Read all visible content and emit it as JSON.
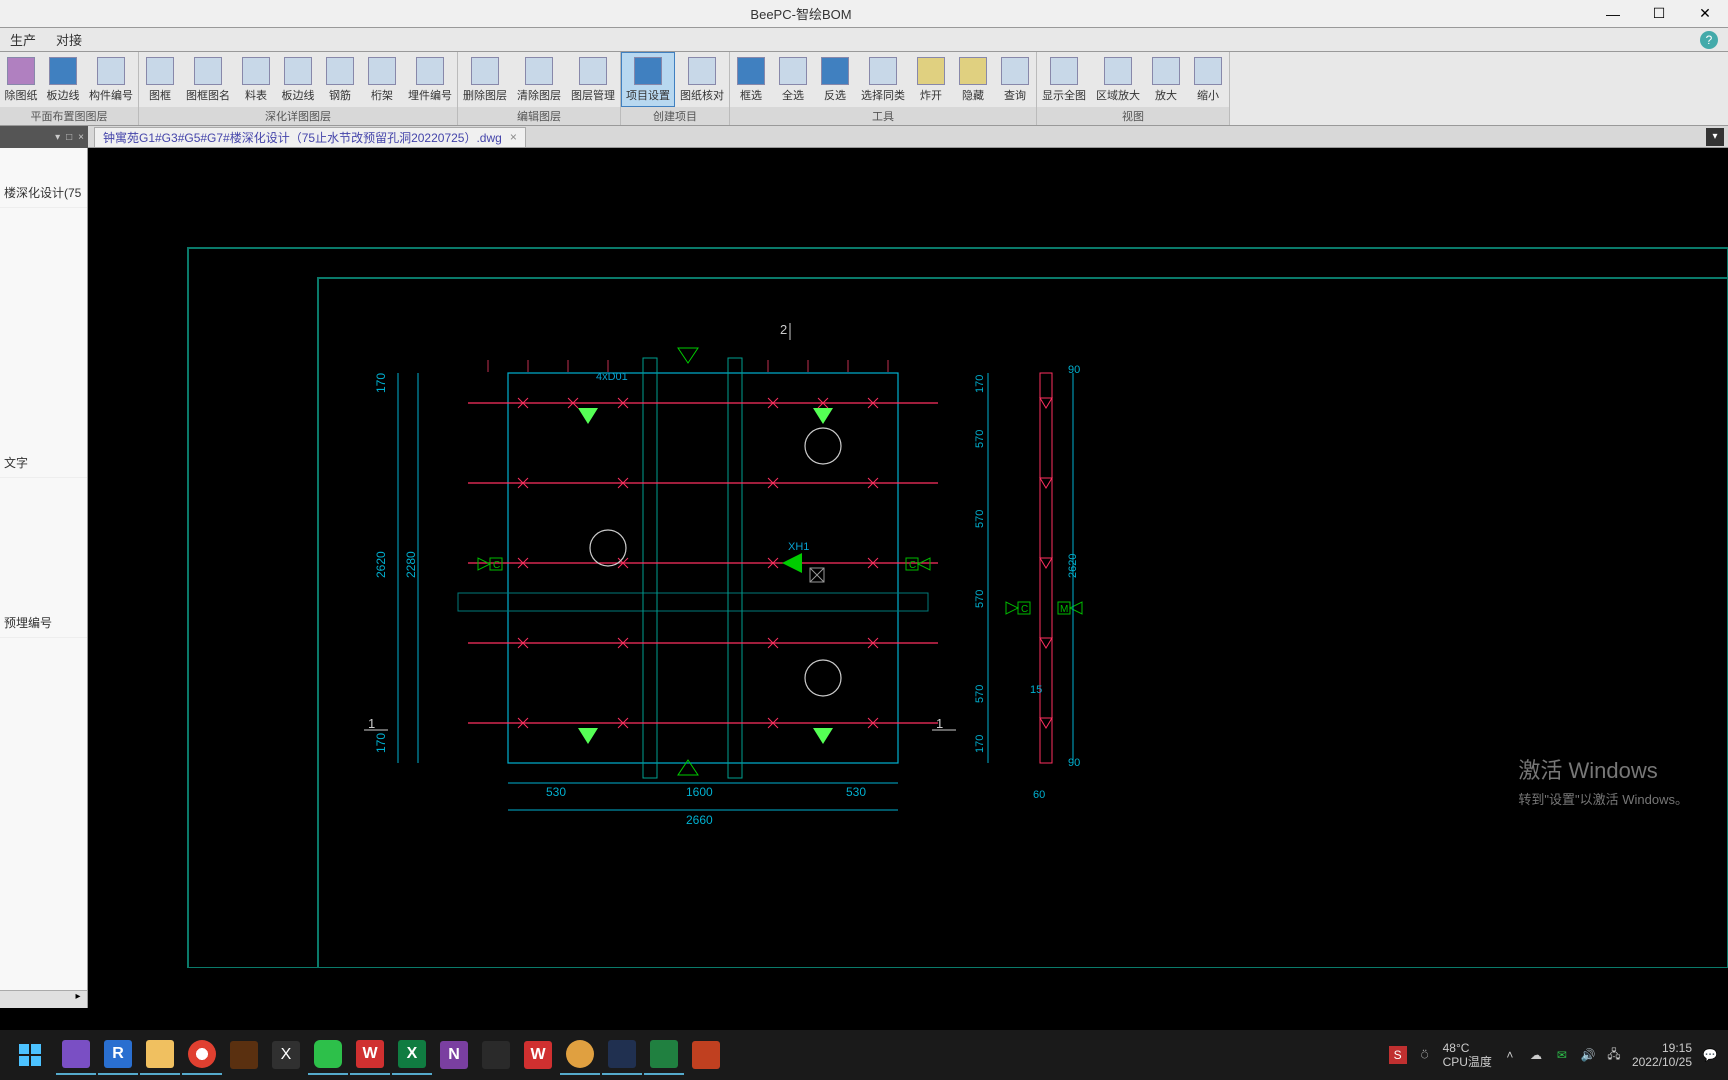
{
  "title": "BeePC-智绘BOM",
  "menu": {
    "produce": "生产",
    "dock": "对接"
  },
  "ribbon": {
    "g1": {
      "drawing": "除图纸",
      "edge": "板边线",
      "id": "构件编号",
      "label": "平面布置图图层"
    },
    "g2": {
      "frame": "图框",
      "name": "图框图名",
      "table": "料表",
      "edge": "板边线",
      "rebar": "钢筋",
      "truss": "桁架",
      "embed": "埋件编号",
      "label": "深化详图图层"
    },
    "g3": {
      "del": "删除图层",
      "clear": "清除图层",
      "mgr": "图层管理",
      "label": "编辑图层"
    },
    "g4": {
      "proj": "项目设置",
      "check": "图纸核对",
      "label": "创建项目"
    },
    "g5": {
      "box": "框选",
      "all": "全选",
      "inv": "反选",
      "same": "选择同类",
      "explode": "炸开",
      "hide": "隐藏",
      "query": "查询",
      "label": "工具"
    },
    "g6": {
      "full": "显示全图",
      "zoomr": "区域放大",
      "zoomin": "放大",
      "zoomout": "缩小",
      "label": "视图"
    }
  },
  "doc_tab": "钟寓苑G1#G3#G5#G7#楼深化设计（75止水节改预留孔洞20220725）.dwg",
  "sidebar": {
    "item1": "楼深化设计(75",
    "item2": "文字",
    "item3": "预埋编号"
  },
  "drawing": {
    "top_label": "2",
    "left_num": "1",
    "right_num": "1",
    "dim_170": "170",
    "dim_2620": "2620",
    "dim_2280": "2280",
    "dim_530": "530",
    "dim_1600": "1600",
    "dim_2660": "2660",
    "dim_90": "90",
    "dim_570": "570",
    "dim_15": "15",
    "dim_60": "60",
    "label_4xd01": "4xD01",
    "label_xh1": "XH1",
    "label_c": "C",
    "label_m": "M"
  },
  "watermark": {
    "title": "激活 Windows",
    "sub": "转到\"设置\"以激活 Windows。"
  },
  "tray": {
    "temp_val": "48°C",
    "temp_label": "CPU温度",
    "time": "19:15",
    "date": "2022/10/25"
  }
}
